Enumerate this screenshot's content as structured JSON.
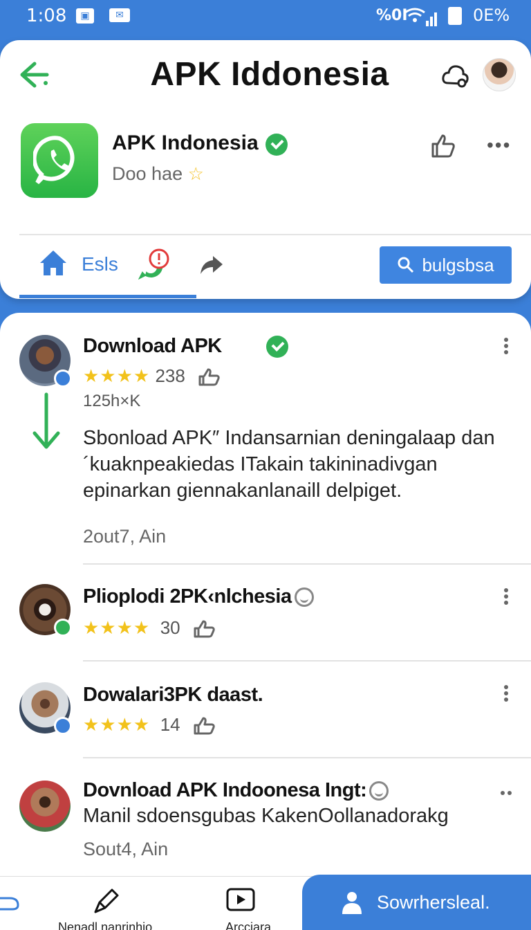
{
  "status_bar": {
    "time": "1:08",
    "network": "%0I",
    "battery": "0E%"
  },
  "header": {
    "title": "APK Iddonesia"
  },
  "app": {
    "name": "APK Indonesia",
    "subtitle": "Doo hae",
    "icon_color": "#33bd4f"
  },
  "tabs": {
    "active_label": "Esls",
    "search_button": "bulgsbsa"
  },
  "feed": [
    {
      "title": "Download APK",
      "rating_value": "238",
      "meta": "125h×K",
      "body": "Sbonload APK″ Indansarnian deningalaap dan´kuaknpeakiedas ITakain takininadivgan epinarkan giennakanlanaill delpiget.",
      "date": "2out7, Ain"
    },
    {
      "title": "Plioplodi 2PK‹nlchesia",
      "rating_value": "30"
    },
    {
      "title": "Dowalari3PK daast.",
      "rating_value": "14"
    },
    {
      "title": "Dovnload APK  Indoonesa Ingt:",
      "body": "Manil sdoensgubas KakenOollanadorakg",
      "date": "Sout4, Ain"
    }
  ],
  "bottom_nav": {
    "left_label": "Nenadl nanrinhio",
    "middle_label": "Arcciara",
    "fab_label": "Sowrhersleal."
  },
  "colors": {
    "primary": "#3b7fd8",
    "green": "#31b157",
    "star": "#f2c21b"
  }
}
